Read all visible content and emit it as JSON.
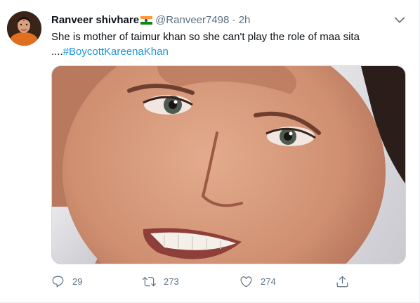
{
  "tweet": {
    "author_name": "Ranveer shivhare",
    "handle_time": "@Ranveer7498 · 2h",
    "text_main": "She is mother of taimur khan so she can't play the role of maa sita",
    "text_prefix": "....",
    "hashtag": "#BoycottKareenaKhan"
  },
  "actions": {
    "reply_count": "29",
    "retweet_count": "273",
    "like_count": "274"
  },
  "icons": [
    "caret-down-icon",
    "reply-icon",
    "retweet-icon",
    "like-icon",
    "share-icon"
  ],
  "colors": {
    "link": "#1b95e0",
    "secondary_text": "#5b7083",
    "flag_saffron": "#ff9933",
    "flag_green": "#138808"
  }
}
